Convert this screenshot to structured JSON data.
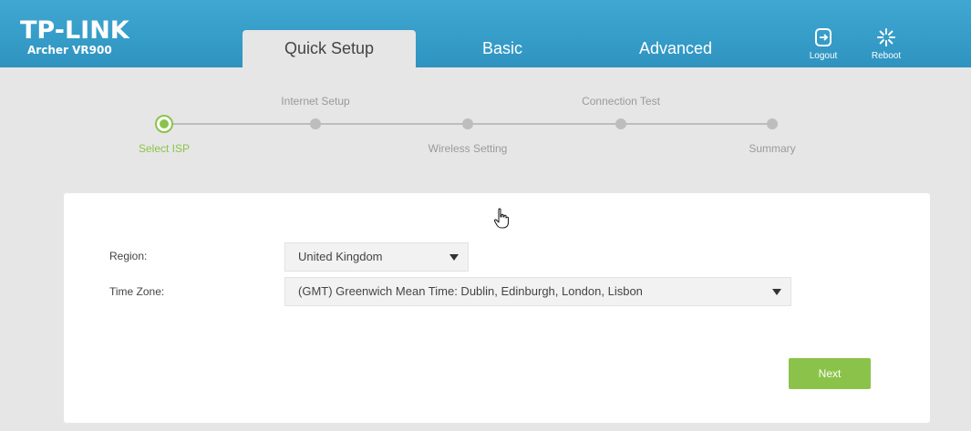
{
  "header": {
    "brand": "TP-LINK",
    "model": "Archer VR900",
    "tabs": [
      {
        "label": "Quick Setup",
        "active": true
      },
      {
        "label": "Basic",
        "active": false
      },
      {
        "label": "Advanced",
        "active": false
      }
    ],
    "logout_label": "Logout",
    "reboot_label": "Reboot"
  },
  "progress": {
    "steps": [
      {
        "label": "Select ISP",
        "current": true
      },
      {
        "label": "Internet Setup",
        "current": false
      },
      {
        "label": "Wireless Setting",
        "current": false
      },
      {
        "label": "Connection Test",
        "current": false
      },
      {
        "label": "Summary",
        "current": false
      }
    ]
  },
  "form": {
    "region_label": "Region:",
    "region_value": "United Kingdom",
    "timezone_label": "Time Zone:",
    "timezone_value": "(GMT) Greenwich Mean Time: Dublin, Edinburgh, London, Lisbon",
    "next_label": "Next"
  },
  "colors": {
    "header": "#3a9fc9",
    "accent_green": "#8bc34a",
    "background": "#e6e6e6"
  },
  "icons": {
    "logout": "logout-icon",
    "reboot": "reboot-icon",
    "cursor": "hand-pointer-icon"
  }
}
